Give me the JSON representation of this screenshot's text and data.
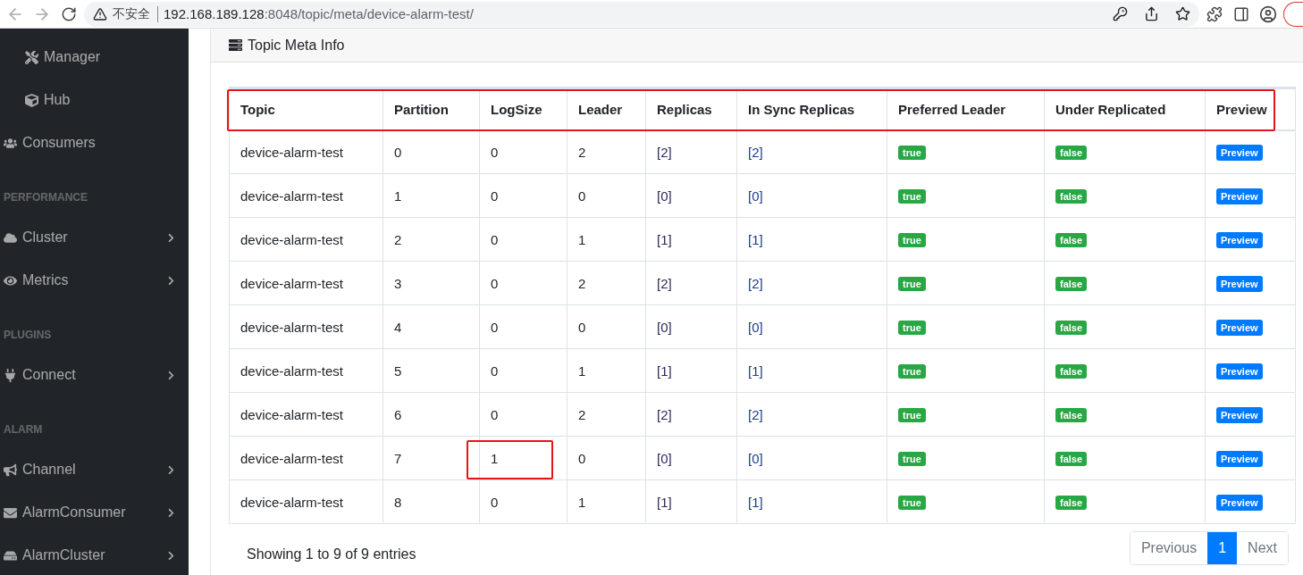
{
  "browser": {
    "security_label": "不安全",
    "url_host": "192.168.189.128",
    "url_rest": ":8048/topic/meta/device-alarm-test/"
  },
  "sidebar": {
    "items": [
      {
        "kind": "subitem",
        "label": "Manager",
        "expandable": false
      },
      {
        "kind": "subitem",
        "label": "Hub",
        "expandable": false
      },
      {
        "kind": "item",
        "label": "Consumers",
        "expandable": false
      },
      {
        "kind": "section",
        "label": "PERFORMANCE"
      },
      {
        "kind": "item",
        "label": "Cluster",
        "expandable": true
      },
      {
        "kind": "item",
        "label": "Metrics",
        "expandable": true
      },
      {
        "kind": "section",
        "label": "PLUGINS"
      },
      {
        "kind": "item",
        "label": "Connect",
        "expandable": true
      },
      {
        "kind": "section",
        "label": "ALARM"
      },
      {
        "kind": "item",
        "label": "Channel",
        "expandable": true
      },
      {
        "kind": "item",
        "label": "AlarmConsumer",
        "expandable": true
      },
      {
        "kind": "item",
        "label": "AlarmCluster",
        "expandable": true
      }
    ]
  },
  "card": {
    "title": "Topic Meta Info"
  },
  "table": {
    "header_outlined": true,
    "columns": [
      "Topic",
      "Partition",
      "LogSize",
      "Leader",
      "Replicas",
      "In Sync Replicas",
      "Preferred Leader",
      "Under Replicated",
      "Preview"
    ],
    "rows": [
      {
        "topic": "device-alarm-test",
        "partition": "0",
        "logsize": "0",
        "leader": "2",
        "replicas": "[2]",
        "isr": "[2]",
        "preferred_leader": "true",
        "under_replicated": "false",
        "preview": "Preview",
        "logsize_outlined": false
      },
      {
        "topic": "device-alarm-test",
        "partition": "1",
        "logsize": "0",
        "leader": "0",
        "replicas": "[0]",
        "isr": "[0]",
        "preferred_leader": "true",
        "under_replicated": "false",
        "preview": "Preview",
        "logsize_outlined": false
      },
      {
        "topic": "device-alarm-test",
        "partition": "2",
        "logsize": "0",
        "leader": "1",
        "replicas": "[1]",
        "isr": "[1]",
        "preferred_leader": "true",
        "under_replicated": "false",
        "preview": "Preview",
        "logsize_outlined": false
      },
      {
        "topic": "device-alarm-test",
        "partition": "3",
        "logsize": "0",
        "leader": "2",
        "replicas": "[2]",
        "isr": "[2]",
        "preferred_leader": "true",
        "under_replicated": "false",
        "preview": "Preview",
        "logsize_outlined": false
      },
      {
        "topic": "device-alarm-test",
        "partition": "4",
        "logsize": "0",
        "leader": "0",
        "replicas": "[0]",
        "isr": "[0]",
        "preferred_leader": "true",
        "under_replicated": "false",
        "preview": "Preview",
        "logsize_outlined": false
      },
      {
        "topic": "device-alarm-test",
        "partition": "5",
        "logsize": "0",
        "leader": "1",
        "replicas": "[1]",
        "isr": "[1]",
        "preferred_leader": "true",
        "under_replicated": "false",
        "preview": "Preview",
        "logsize_outlined": false
      },
      {
        "topic": "device-alarm-test",
        "partition": "6",
        "logsize": "0",
        "leader": "2",
        "replicas": "[2]",
        "isr": "[2]",
        "preferred_leader": "true",
        "under_replicated": "false",
        "preview": "Preview",
        "logsize_outlined": false
      },
      {
        "topic": "device-alarm-test",
        "partition": "7",
        "logsize": "1",
        "leader": "0",
        "replicas": "[0]",
        "isr": "[0]",
        "preferred_leader": "true",
        "under_replicated": "false",
        "preview": "Preview",
        "logsize_outlined": true
      },
      {
        "topic": "device-alarm-test",
        "partition": "8",
        "logsize": "0",
        "leader": "1",
        "replicas": "[1]",
        "isr": "[1]",
        "preferred_leader": "true",
        "under_replicated": "false",
        "preview": "Preview",
        "logsize_outlined": false
      }
    ]
  },
  "footer": {
    "info": "Showing 1 to 9 of 9 entries"
  },
  "pagination": {
    "previous": "Previous",
    "pages": [
      {
        "label": "1",
        "selected": true
      }
    ],
    "next": "Next"
  }
}
